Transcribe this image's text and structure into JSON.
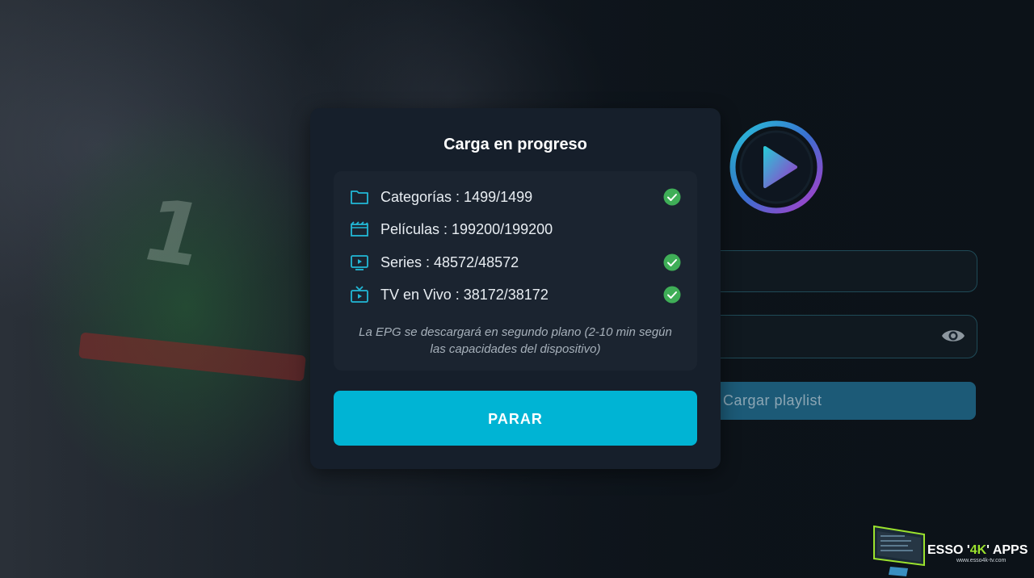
{
  "dialog": {
    "title": "Carga en progreso",
    "rows": [
      {
        "label": "Categorías : 1499/1499",
        "icon": "folder-icon",
        "done": true
      },
      {
        "label": "Películas : 199200/199200",
        "icon": "movie-clapper-icon",
        "done": false
      },
      {
        "label": "Series : 48572/48572",
        "icon": "series-screen-icon",
        "done": true
      },
      {
        "label": "TV en Vivo : 38172/38172",
        "icon": "tv-icon",
        "done": true
      }
    ],
    "epg_note": "La EPG se descargará en segundo plano (2-10 min según las capacidades del dispositivo)",
    "stop_label": "PARAR"
  },
  "form": {
    "load_label": "Cargar playlist"
  },
  "watermark": {
    "brand_pre": "ESSO '",
    "brand_accent": "4K",
    "brand_post": "' APPS",
    "url": "www.esso4k-tv.com"
  },
  "colors": {
    "accent": "#00b4d4",
    "check": "#3fae57",
    "icon": "#22b8d6"
  }
}
